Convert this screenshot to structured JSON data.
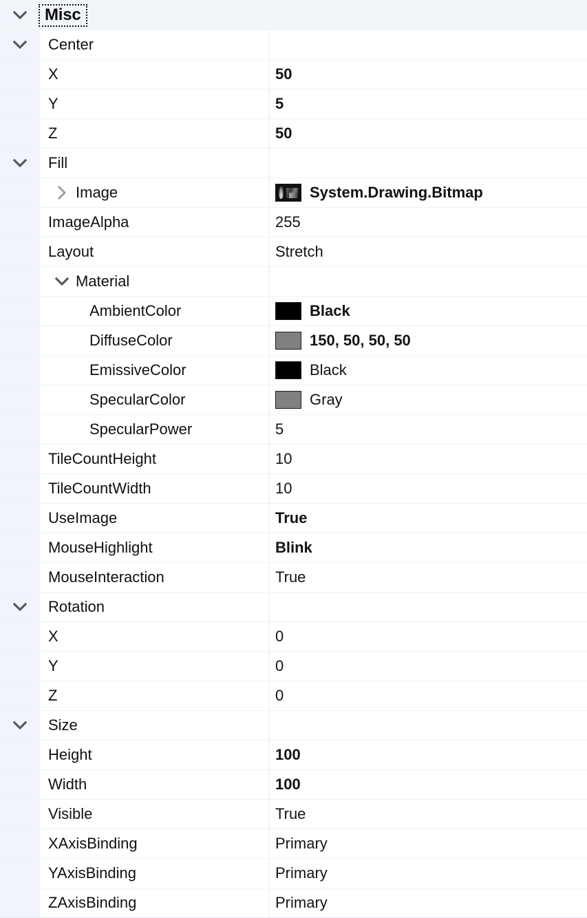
{
  "panel": {
    "type": "property-grid",
    "category": {
      "label": "Misc",
      "expanded": true,
      "focused": true
    }
  },
  "colors": {
    "gutter": "#f1f4fa",
    "category_background": "#f2f5fa",
    "row_background": "#ffffff",
    "row_separator": "#eef2f7",
    "text": "#0f1012",
    "chevron": "#555a60",
    "sub_chevron": "#9aa0a6",
    "swatch_black": "#000000",
    "swatch_gray": "#808080"
  },
  "rows": [
    {
      "name": "Center",
      "value": "",
      "level": 1,
      "twisty": "expanded",
      "bold_value": false,
      "swatch": null
    },
    {
      "name": "X",
      "value": "50",
      "level": 2,
      "twisty": "none",
      "bold_value": true,
      "swatch": null
    },
    {
      "name": "Y",
      "value": "5",
      "level": 2,
      "twisty": "none",
      "bold_value": true,
      "swatch": null
    },
    {
      "name": "Z",
      "value": "50",
      "level": 2,
      "twisty": "none",
      "bold_value": true,
      "swatch": null
    },
    {
      "name": "Fill",
      "value": "",
      "level": 1,
      "twisty": "expanded",
      "bold_value": false,
      "swatch": null
    },
    {
      "name": "Image",
      "value": "System.Drawing.Bitmap",
      "level": 2,
      "twisty": "collapsed-inline",
      "bold_value": true,
      "swatch": "bitmap"
    },
    {
      "name": "ImageAlpha",
      "value": "255",
      "level": 2,
      "twisty": "none",
      "bold_value": false,
      "swatch": null
    },
    {
      "name": "Layout",
      "value": "Stretch",
      "level": 2,
      "twisty": "none",
      "bold_value": false,
      "swatch": null
    },
    {
      "name": "Material",
      "value": "",
      "level": 2,
      "twisty": "expanded-inline",
      "bold_value": false,
      "swatch": null
    },
    {
      "name": "AmbientColor",
      "value": "Black",
      "level": 3,
      "twisty": "none",
      "bold_value": true,
      "swatch": "#000000"
    },
    {
      "name": "DiffuseColor",
      "value": "150, 50, 50, 50",
      "level": 3,
      "twisty": "none",
      "bold_value": true,
      "swatch": "#808080"
    },
    {
      "name": "EmissiveColor",
      "value": "Black",
      "level": 3,
      "twisty": "none",
      "bold_value": false,
      "swatch": "#000000"
    },
    {
      "name": "SpecularColor",
      "value": "Gray",
      "level": 3,
      "twisty": "none",
      "bold_value": false,
      "swatch": "#808080"
    },
    {
      "name": "SpecularPower",
      "value": "5",
      "level": 3,
      "twisty": "none",
      "bold_value": false,
      "swatch": null
    },
    {
      "name": "TileCountHeight",
      "value": "10",
      "level": 2,
      "twisty": "none",
      "bold_value": false,
      "swatch": null
    },
    {
      "name": "TileCountWidth",
      "value": "10",
      "level": 2,
      "twisty": "none",
      "bold_value": false,
      "swatch": null
    },
    {
      "name": "UseImage",
      "value": "True",
      "level": 2,
      "twisty": "none",
      "bold_value": true,
      "swatch": null
    },
    {
      "name": "MouseHighlight",
      "value": "Blink",
      "level": 1,
      "twisty": "none",
      "bold_value": true,
      "swatch": null
    },
    {
      "name": "MouseInteraction",
      "value": "True",
      "level": 1,
      "twisty": "none",
      "bold_value": false,
      "swatch": null
    },
    {
      "name": "Rotation",
      "value": "",
      "level": 1,
      "twisty": "expanded",
      "bold_value": false,
      "swatch": null
    },
    {
      "name": "X",
      "value": "0",
      "level": 2,
      "twisty": "none",
      "bold_value": false,
      "swatch": null
    },
    {
      "name": "Y",
      "value": "0",
      "level": 2,
      "twisty": "none",
      "bold_value": false,
      "swatch": null
    },
    {
      "name": "Z",
      "value": "0",
      "level": 2,
      "twisty": "none",
      "bold_value": false,
      "swatch": null
    },
    {
      "name": "Size",
      "value": "",
      "level": 1,
      "twisty": "expanded",
      "bold_value": false,
      "swatch": null
    },
    {
      "name": "Height",
      "value": "100",
      "level": 2,
      "twisty": "none",
      "bold_value": true,
      "swatch": null
    },
    {
      "name": "Width",
      "value": "100",
      "level": 2,
      "twisty": "none",
      "bold_value": true,
      "swatch": null
    },
    {
      "name": "Visible",
      "value": "True",
      "level": 1,
      "twisty": "none",
      "bold_value": false,
      "swatch": null
    },
    {
      "name": "XAxisBinding",
      "value": "Primary",
      "level": 1,
      "twisty": "none",
      "bold_value": false,
      "swatch": null
    },
    {
      "name": "YAxisBinding",
      "value": "Primary",
      "level": 1,
      "twisty": "none",
      "bold_value": false,
      "swatch": null
    },
    {
      "name": "ZAxisBinding",
      "value": "Primary",
      "level": 1,
      "twisty": "none",
      "bold_value": false,
      "swatch": null
    }
  ]
}
